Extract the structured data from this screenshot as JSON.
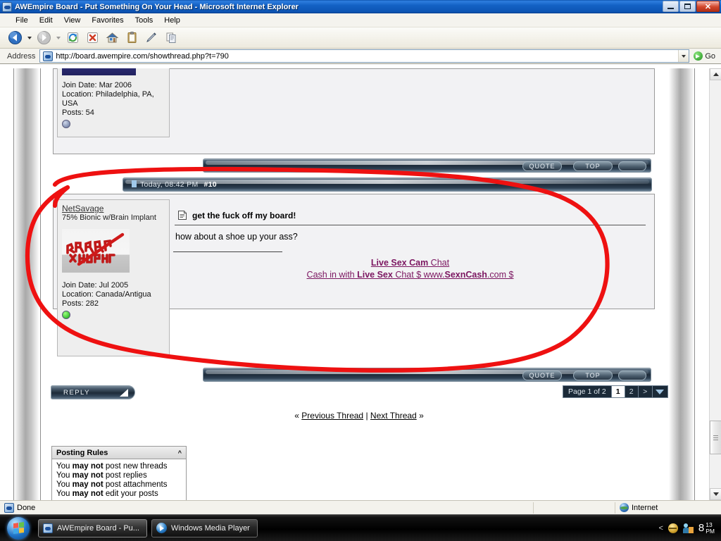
{
  "window": {
    "title": "AWEmpire Board - Put Something On Your Head - Microsoft Internet Explorer",
    "icon": "ie-icon",
    "minimize_label": "",
    "maximize_label": "",
    "close_label": "✕"
  },
  "menubar": {
    "items": [
      "File",
      "Edit",
      "View",
      "Favorites",
      "Tools",
      "Help"
    ]
  },
  "toolbar": {
    "buttons": [
      {
        "name": "back-button",
        "label": "Back"
      },
      {
        "name": "back-dropdown",
        "label": ""
      },
      {
        "name": "forward-button",
        "label": "Forward"
      },
      {
        "name": "forward-dropdown",
        "label": ""
      },
      {
        "name": "refresh-button",
        "label": "Refresh"
      },
      {
        "name": "stop-button",
        "label": "Stop"
      },
      {
        "name": "home-button",
        "label": "Home"
      },
      {
        "name": "notes-button",
        "label": "Notes"
      },
      {
        "name": "edit-button",
        "label": "Edit"
      },
      {
        "name": "copy-button",
        "label": "Copy"
      }
    ]
  },
  "address": {
    "label": "Address",
    "url": "http://board.awempire.com/showthread.php?t=790",
    "placeholder": "",
    "go_label": "Go"
  },
  "page": {
    "post_previous": {
      "join_date": "Join Date: Mar 2006",
      "location": "Location: Philadelphia, PA, USA",
      "posts": "Posts: 54"
    },
    "post_actions_top": {
      "quote_label": "QUOTE",
      "top_label": "TOP"
    },
    "post": {
      "header_date": "Today, 08:42 PM",
      "header_number": "#10",
      "username": "NetSavage",
      "user_title": "75% Bionic w/Brain Implant",
      "join_date": "Join Date: Jul 2005",
      "location": "Location: Canada/Antigua",
      "posts": "Posts: 282",
      "status": "online",
      "title": "get the fuck off my board!",
      "body": "how about a shoe up your ass?",
      "signature": {
        "line1_bold": "Live Sex Cam",
        "line1_rest": " Chat",
        "line2_pre": "Cash in with ",
        "line2_bold1": "Live Sex",
        "line2_mid": " Chat $ www.",
        "line2_bold2": "SexnCash",
        "line2_post": ".com $"
      }
    },
    "post_actions_bottom": {
      "quote_label": "QUOTE",
      "top_label": "TOP"
    },
    "reply_label": "REPLY",
    "pager": {
      "page_label": "Page 1 of 2",
      "pages": [
        "1",
        "2"
      ],
      "current": "1",
      "next_label": ">",
      "dropdown_label": ""
    },
    "thread_nav": {
      "prev_arrow": "«",
      "prev_label": "Previous Thread",
      "divider": "|",
      "next_label": "Next Thread",
      "next_arrow": "»"
    },
    "posting_rules": {
      "title": "Posting Rules",
      "collapse_icon": "^",
      "rules": [
        {
          "pre": "You ",
          "bold": "may not",
          "post": " post new threads"
        },
        {
          "pre": "You ",
          "bold": "may not",
          "post": " post replies"
        },
        {
          "pre": "You ",
          "bold": "may not",
          "post": " post attachments"
        },
        {
          "pre": "You ",
          "bold": "may not",
          "post": " edit your posts"
        }
      ]
    }
  },
  "statusbar": {
    "text": "Done",
    "zone": "Internet"
  },
  "taskbar": {
    "start_label": "",
    "items": [
      {
        "name": "taskbar-item-ie",
        "label": "AWEmpire Board - Pu...",
        "active": true
      },
      {
        "name": "taskbar-item-wmp",
        "label": "Windows Media Player",
        "active": false
      }
    ],
    "tray_chevron": "<",
    "clock_hour": "8",
    "clock_minute": "13",
    "clock_meridiem": "PM"
  },
  "annotation": {
    "type": "freehand-circle",
    "color": "#ee1111",
    "stroke_width": 6
  },
  "colors": {
    "title_bar": "#1361c4",
    "link": "#7b1560",
    "annotation_red": "#ee1111",
    "chrome_dark": "#1e2c3a",
    "status_online": "#0fa70f"
  }
}
